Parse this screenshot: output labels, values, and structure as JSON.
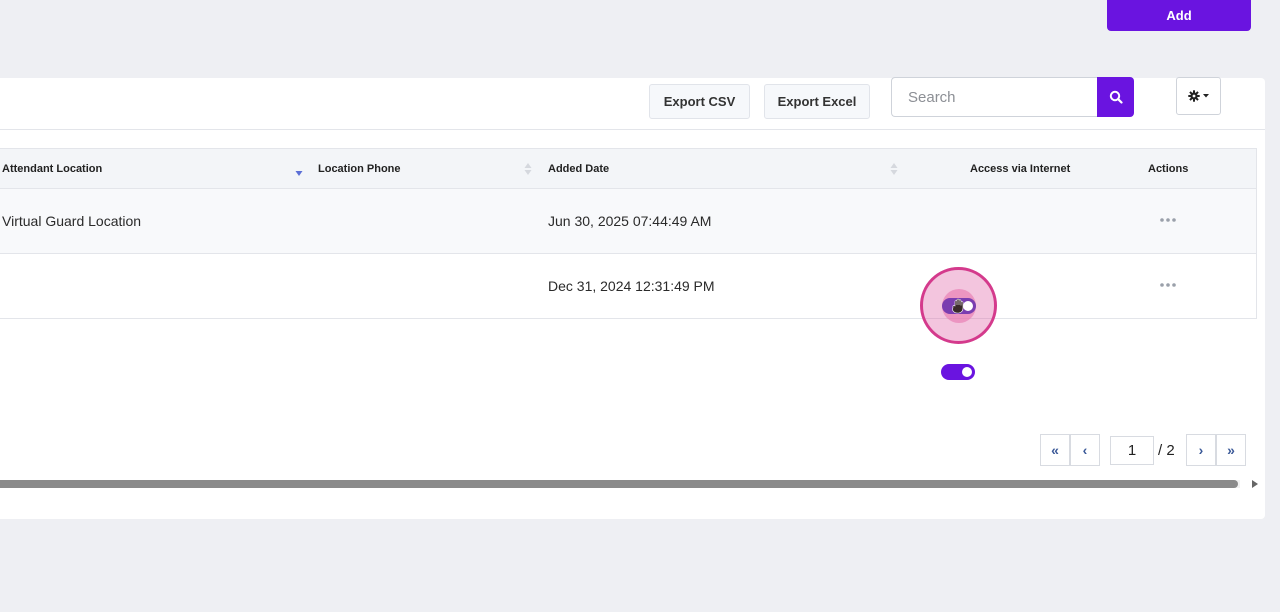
{
  "toolbar": {
    "add_label": "Add",
    "export_csv_label": "Export CSV",
    "export_excel_label": "Export Excel",
    "search_placeholder": "Search",
    "search_value": ""
  },
  "table": {
    "columns": [
      {
        "label": "Attendant Location",
        "sort": "desc"
      },
      {
        "label": "Location Phone",
        "sort": "none"
      },
      {
        "label": "Added Date",
        "sort": "none"
      },
      {
        "label": "Access via Internet",
        "sort": null
      },
      {
        "label": "Actions",
        "sort": null
      }
    ],
    "rows": [
      {
        "attendant_location": "Virtual Guard Location",
        "location_phone": "",
        "added_date": "Jun 30, 2025 07:44:49 AM",
        "access_via_internet": true
      },
      {
        "attendant_location": "",
        "location_phone": "",
        "added_date": "Dec 31, 2024 12:31:49 PM",
        "access_via_internet": true
      }
    ]
  },
  "pagination": {
    "first_label": "«",
    "prev_label": "‹",
    "next_label": "›",
    "last_label": "»",
    "current_page": "1",
    "total_label": "/ 2"
  },
  "colors": {
    "accent": "#6a14e0",
    "background": "#eeeff3",
    "click_highlight": "#d43a8c"
  },
  "icons": [
    "search-icon",
    "gear-icon",
    "caret-down-icon",
    "sort-icon",
    "more-dots-icon",
    "hand-cursor-icon"
  ]
}
